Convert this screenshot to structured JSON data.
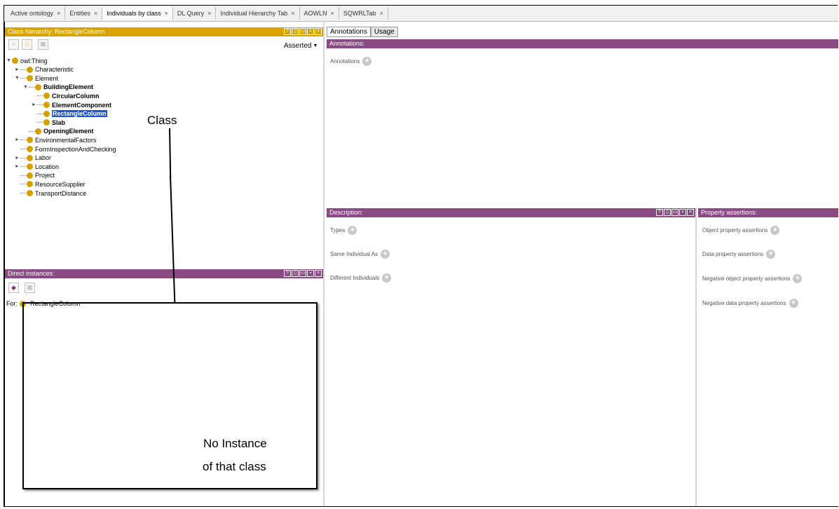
{
  "tabs": [
    {
      "label": "Active ontology"
    },
    {
      "label": "Entities"
    },
    {
      "label": "Individuals by class"
    },
    {
      "label": "DL Query"
    },
    {
      "label": "Individual Hierarchy Tab"
    },
    {
      "label": "AOWLN"
    },
    {
      "label": "SQWRLTab"
    }
  ],
  "tab_close": "×",
  "class_hierarchy": {
    "title": "Class hierarchy: RectangleColumn",
    "asserted": "Asserted",
    "tree": [
      {
        "label": "owl:Thing",
        "depth": 0,
        "arrow": "▼",
        "bold": false
      },
      {
        "label": "Characteristic",
        "depth": 1,
        "arrow": "►",
        "bold": false
      },
      {
        "label": "Element",
        "depth": 1,
        "arrow": "▼",
        "bold": false
      },
      {
        "label": "BuildingElement",
        "depth": 2,
        "arrow": "▼",
        "bold": true
      },
      {
        "label": "CircularColumn",
        "depth": 3,
        "arrow": "",
        "bold": true
      },
      {
        "label": "ElementComponent",
        "depth": 3,
        "arrow": "►",
        "bold": true
      },
      {
        "label": "RectangleColumn",
        "depth": 3,
        "arrow": "",
        "bold": true,
        "selected": true
      },
      {
        "label": "Slab",
        "depth": 3,
        "arrow": "",
        "bold": true
      },
      {
        "label": "OpeningElement",
        "depth": 2,
        "arrow": "",
        "bold": true
      },
      {
        "label": "EnvironmentalFactors",
        "depth": 1,
        "arrow": "►",
        "bold": false
      },
      {
        "label": "FormInspectionAndChecking",
        "depth": 1,
        "arrow": "",
        "bold": false
      },
      {
        "label": "Labor",
        "depth": 1,
        "arrow": "►",
        "bold": false
      },
      {
        "label": "Location",
        "depth": 1,
        "arrow": "►",
        "bold": false
      },
      {
        "label": "Project",
        "depth": 1,
        "arrow": "",
        "bold": false
      },
      {
        "label": "ResourceSupplier",
        "depth": 1,
        "arrow": "",
        "bold": false
      },
      {
        "label": "TransportDistance",
        "depth": 1,
        "arrow": "",
        "bold": false
      }
    ]
  },
  "direct_instances": {
    "title": "Direct instances:",
    "for_label": "For:",
    "for_class": "RectangleColumn"
  },
  "right_tabs": [
    {
      "label": "Annotations"
    },
    {
      "label": "Usage"
    }
  ],
  "annotations": {
    "title": "Annotations:",
    "field": "Annotations"
  },
  "description": {
    "title": "Description:",
    "fields": [
      "Types",
      "Same Individual As",
      "Different Individuals"
    ]
  },
  "property_assertions": {
    "title": "Property assertions:",
    "fields": [
      "Object property assertions",
      "Data property assertions",
      "Negative object property assertions",
      "Negative data property assertions"
    ]
  },
  "callouts": {
    "class": "Class",
    "no_instance_line1": "No Instance",
    "no_instance_line2": "of that class"
  },
  "colors": {
    "yellow": "#d9a400",
    "purple": "#8a4a83",
    "selection": "#2255cc"
  }
}
